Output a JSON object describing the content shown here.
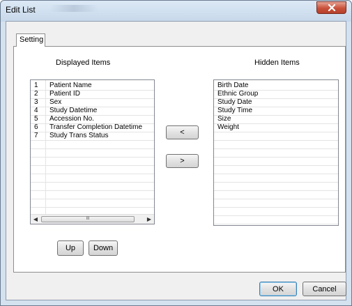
{
  "window": {
    "title": "Edit List"
  },
  "tabs": [
    {
      "label": "Setting"
    }
  ],
  "displayed": {
    "heading": "Displayed Items",
    "rows": [
      {
        "num": "1",
        "name": "Patient Name"
      },
      {
        "num": "2",
        "name": "Patient ID"
      },
      {
        "num": "3",
        "name": "Sex"
      },
      {
        "num": "4",
        "name": "Study Datetime"
      },
      {
        "num": "5",
        "name": "Accession No."
      },
      {
        "num": "6",
        "name": "Transfer Completion Datetime"
      },
      {
        "num": "7",
        "name": "Study Trans Status"
      }
    ]
  },
  "hidden": {
    "heading": "Hidden Items",
    "rows": [
      "Birth Date",
      "Ethnic Group",
      "Study Date",
      "Study Time",
      "Size",
      "Weight"
    ]
  },
  "buttons": {
    "move_left": "<",
    "move_right": ">",
    "up": "Up",
    "down": "Down",
    "ok": "OK",
    "cancel": "Cancel"
  },
  "scrollbar": {
    "grip": "III"
  },
  "icons": {
    "close": "close-icon",
    "scroll_left": "scroll-left-arrow-icon",
    "scroll_right": "scroll-right-arrow-icon"
  }
}
